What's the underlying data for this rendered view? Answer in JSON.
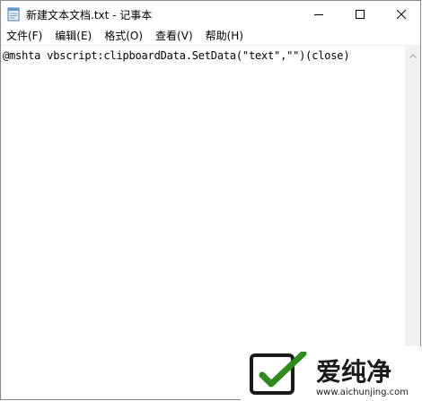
{
  "window": {
    "title": "新建文本文档.txt - 记事本",
    "app_icon": "notepad-icon",
    "controls": {
      "minimize_icon": "minimize-icon",
      "maximize_icon": "maximize-icon",
      "close_icon": "close-icon"
    }
  },
  "menubar": {
    "items": [
      {
        "label": "文件(F)"
      },
      {
        "label": "编辑(E)"
      },
      {
        "label": "格式(O)"
      },
      {
        "label": "查看(V)"
      },
      {
        "label": "帮助(H)"
      }
    ]
  },
  "editor": {
    "content": "@mshta vbscript:clipboardData.SetData(\"text\",\"\")(close)"
  },
  "scrollbar": {
    "up_icon": "scroll-up-icon",
    "down_icon": "scroll-down-icon"
  },
  "watermark": {
    "brand_text": "爱纯净",
    "url": "www.aichunjing.com",
    "colors": {
      "green": "#2e8b1e",
      "dark": "#1a1a1a"
    }
  }
}
